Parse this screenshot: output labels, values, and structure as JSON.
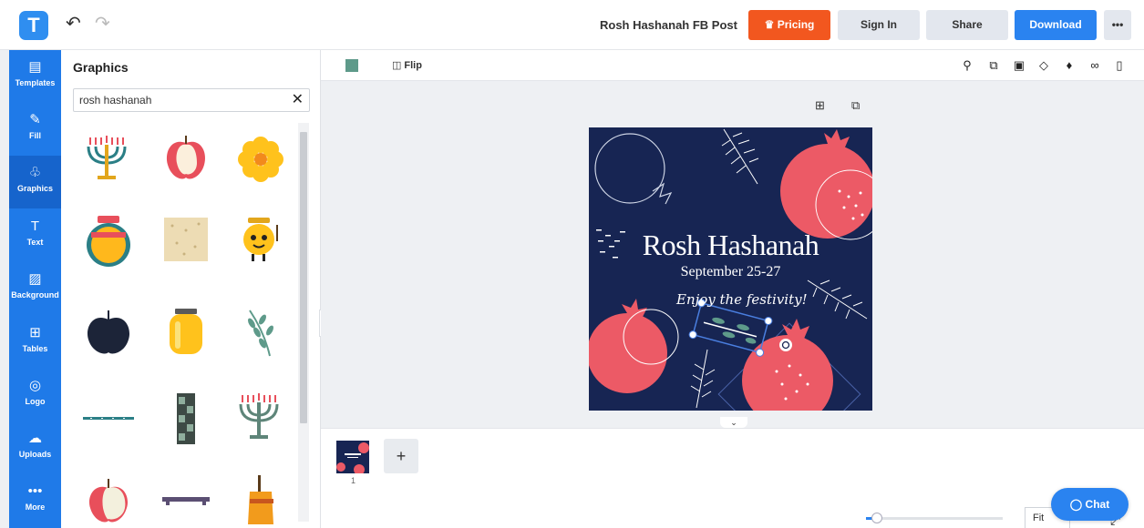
{
  "app": {
    "logo_letter": "T",
    "undo_icon": "↶",
    "redo_icon": "↷"
  },
  "header": {
    "doc_title": "Rosh Hashanah FB Post",
    "pricing_label": "Pricing",
    "signin_label": "Sign In",
    "share_label": "Share",
    "download_label": "Download",
    "more_label": "•••"
  },
  "rail": {
    "items": [
      {
        "label": "Templates",
        "icon": "▤"
      },
      {
        "label": "Fill",
        "icon": "✎"
      },
      {
        "label": "Graphics",
        "icon": "♧"
      },
      {
        "label": "Text",
        "icon": "T"
      },
      {
        "label": "Background",
        "icon": "▨"
      },
      {
        "label": "Tables",
        "icon": "⊞"
      },
      {
        "label": "Logo",
        "icon": "◎"
      },
      {
        "label": "Uploads",
        "icon": "☁"
      },
      {
        "label": "More",
        "icon": "•••"
      }
    ]
  },
  "panel": {
    "title": "Graphics",
    "search_value": "rosh hashanah",
    "clear_icon": "✕"
  },
  "toolbar": {
    "flip_label": "Flip",
    "flip_icon": "◫",
    "fill_color": "#5e9a8a",
    "tools": [
      "paint-roller-icon",
      "copy-icon",
      "layer-icon",
      "water-drop-icon",
      "align-icon",
      "link-icon",
      "trash-icon"
    ]
  },
  "canvas": {
    "add_page_icon": "⊞",
    "duplicate_icon": "⧉",
    "collapse_icon": "‹",
    "expand_icon": "⌄",
    "design_bg": "#172553"
  },
  "design": {
    "title": "Rosh Hashanah",
    "date": "September 25-27",
    "tagline": "Enjoy the festivity!"
  },
  "pages": {
    "page_number": "1",
    "add_label": "+",
    "fit_label": "Fit",
    "zoom_fraction": 0.08
  },
  "chat": {
    "label": "Chat",
    "icon": "◯"
  },
  "colors": {
    "accent_blue": "#2a83f0",
    "pricing_orange": "#f2571f",
    "pomegranate": "#ec5a66",
    "navy": "#172553"
  }
}
